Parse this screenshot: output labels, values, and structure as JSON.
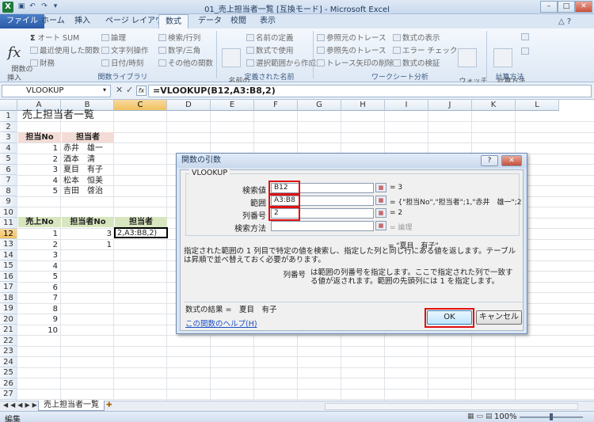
{
  "window": {
    "title": "01_売上担当者一覧 [互換モード] - Microsoft Excel",
    "app_icon": "X"
  },
  "tabs": [
    "ファイル",
    "ホーム",
    "挿入",
    "ページ レイアウト",
    "数式",
    "データ",
    "校閲",
    "表示"
  ],
  "active_tab": "数式",
  "ribbon": {
    "insert_function": "関数の\n挿入",
    "library": [
      "オート SUM",
      "論理",
      "検索/行列",
      "最近使用した関数",
      "文字列操作",
      "数学/三角",
      "財務",
      "日付/時刻",
      "その他の関数"
    ],
    "library_label": "関数ライブラリ",
    "name_manager": "名前の\n管理",
    "names": [
      "名前の定義",
      "数式で使用",
      "選択範囲から作成"
    ],
    "names_label": "定義された名前",
    "audit": [
      "参照元のトレース",
      "数式の表示",
      "参照先のトレース",
      "エラー チェック",
      "トレース矢印の削除",
      "数式の検証"
    ],
    "watch": "ウォッチ\nウィンドウ",
    "audit_label": "ワークシート分析",
    "calc_options": "計算方法\nの設定",
    "calc_label": "計算方法"
  },
  "formula_bar": {
    "name_box": "VLOOKUP",
    "formula": "=VLOOKUP(B12,A3:B8,2)"
  },
  "columns": [
    "A",
    "B",
    "C",
    "D",
    "E",
    "F",
    "G",
    "H",
    "I",
    "J",
    "K",
    "L"
  ],
  "rows": [
    "1",
    "2",
    "3",
    "4",
    "5",
    "6",
    "7",
    "8",
    "9",
    "10",
    "11",
    "12",
    "13",
    "14",
    "15",
    "16",
    "17",
    "18",
    "19",
    "20",
    "21",
    "22",
    "23",
    "24",
    "25",
    "26",
    "27"
  ],
  "sheet": {
    "title": "売上担当者一覧",
    "table1_headers": [
      "担当No",
      "担当者"
    ],
    "table1": [
      [
        "1",
        "赤井　雄一"
      ],
      [
        "2",
        "酒本　清"
      ],
      [
        "3",
        "夏目　有子"
      ],
      [
        "4",
        "松本　恒美"
      ],
      [
        "5",
        "吉田　啓治"
      ]
    ],
    "table2_headers": [
      "売上No",
      "担当者No",
      "担当者"
    ],
    "table2_no": [
      "1",
      "2",
      "3",
      "4",
      "5",
      "6",
      "7",
      "8",
      "9",
      "10"
    ],
    "table2_b": [
      "3",
      "1"
    ],
    "editing_cell": "2,A3:B8,2)"
  },
  "sheet_tab": "売上担当者一覧",
  "status": {
    "mode": "編集",
    "zoom": "100%"
  },
  "dialog": {
    "title": "関数の引数",
    "func": "VLOOKUP",
    "args": [
      {
        "label": "検索値",
        "value": "B12",
        "result": "3"
      },
      {
        "label": "範囲",
        "value": "A3:B8",
        "result": "{\"担当No\",\"担当者\";1,\"赤井　雄一\";2,\""
      },
      {
        "label": "列番号",
        "value": "2",
        "result": "2"
      },
      {
        "label": "検索方法",
        "value": "",
        "result": "論理"
      }
    ],
    "result_preview": "= \"夏目　有子\"",
    "description": "指定された範囲の 1 列目で特定の値を検索し、指定した列と同じ行にある値を返します。テーブルは昇順で並べ替えておく必要があります。",
    "arg_help_name": "列番号",
    "arg_help": "は範囲の列番号を指定します。ここで指定された列で一致する値が返されます。範囲の先頭列には 1 を指定します。",
    "formula_result": "数式の結果 =　夏目　有子",
    "help_link": "この関数のヘルプ(H)",
    "ok": "OK",
    "cancel": "キャンセル"
  }
}
